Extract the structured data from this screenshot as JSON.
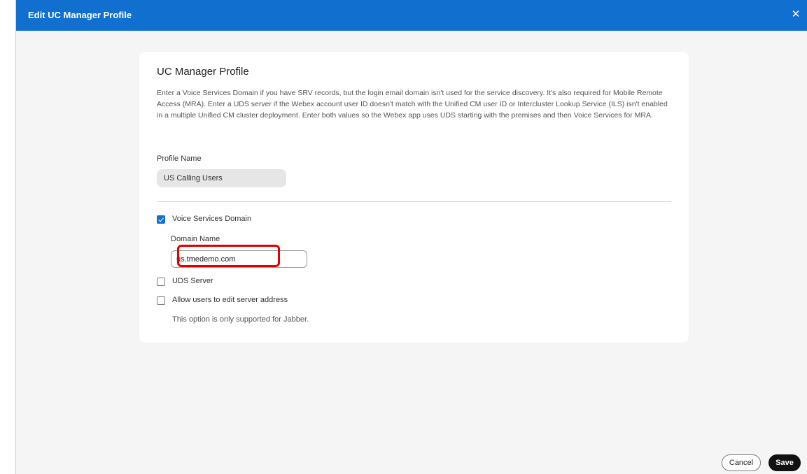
{
  "dialog": {
    "title": "Edit UC Manager Profile",
    "close_icon": "close-icon"
  },
  "card": {
    "title": "UC Manager Profile",
    "description": "Enter a Voice Services Domain if you have SRV records, but the login email domain isn't used for the service discovery. It's also required for Mobile Remote Access (MRA). Enter a UDS server if the Webex account user ID doesn't match with the Unified CM user ID or Intercluster Lookup Service (ILS) isn't enabled in a multiple Unified CM cluster deployment. Enter both values so the Webex app uses UDS starting with the premises and then Voice Services for MRA.",
    "profile_name_label": "Profile Name",
    "profile_name_value": "US Calling Users",
    "voice_services": {
      "label": "Voice Services Domain",
      "checked": true,
      "domain_label": "Domain Name",
      "domain_value": "us.tmedemo.com"
    },
    "uds_server": {
      "label": "UDS Server",
      "checked": false
    },
    "allow_edit": {
      "label": "Allow users to edit server address",
      "checked": false,
      "note": "This option is only supported for Jabber."
    }
  },
  "footer": {
    "cancel_label": "Cancel",
    "save_label": "Save"
  },
  "colors": {
    "titlebar": "#1170cf",
    "highlight": "#e00000",
    "save_button": "#111111"
  }
}
